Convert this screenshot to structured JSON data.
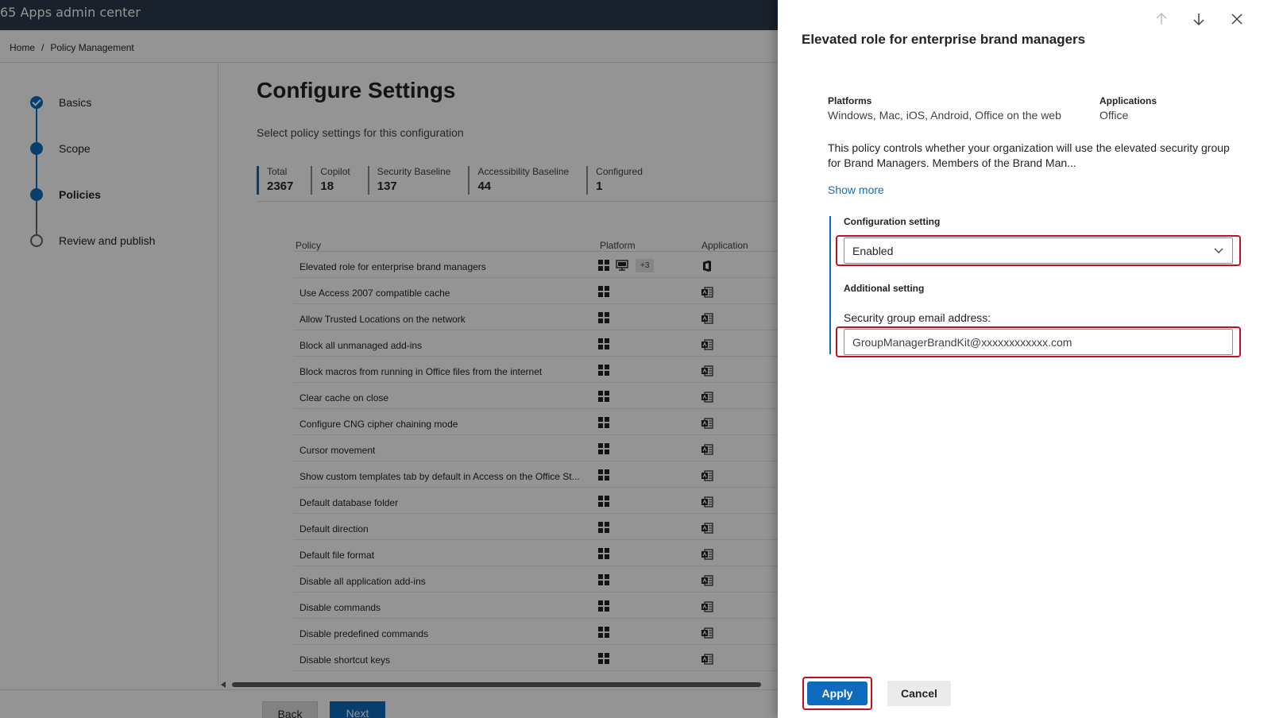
{
  "app": {
    "title": "65 Apps admin center",
    "breadcrumb": {
      "home": "Home",
      "sep": "/",
      "current": "Policy Management"
    }
  },
  "steps": [
    {
      "label": "Basics",
      "state": "complete"
    },
    {
      "label": "Scope",
      "state": "complete"
    },
    {
      "label": "Policies",
      "state": "current"
    },
    {
      "label": "Review and publish",
      "state": "pending"
    }
  ],
  "main": {
    "heading": "Configure Settings",
    "subheading": "Select policy settings for this configuration",
    "stats": [
      {
        "label": "Total",
        "value": "2367"
      },
      {
        "label": "Copilot",
        "value": "18"
      },
      {
        "label": "Security Baseline",
        "value": "137"
      },
      {
        "label": "Accessibility Baseline",
        "value": "44"
      },
      {
        "label": "Configured",
        "value": "1"
      }
    ],
    "table": {
      "headers": {
        "policy": "Policy",
        "platform": "Platform",
        "application": "Application"
      },
      "rows": [
        "Elevated role for enterprise brand managers",
        "Use Access 2007 compatible cache",
        "Allow Trusted Locations on the network",
        "Block all unmanaged add-ins",
        "Block macros from running in Office files from the internet",
        "Clear cache on close",
        "Configure CNG cipher chaining mode",
        "Cursor movement",
        "Show custom templates tab by default in Access on the Office St...",
        "Default database folder",
        "Default direction",
        "Default file format",
        "Disable all application add-ins",
        "Disable commands",
        "Disable predefined commands",
        "Disable shortcut keys"
      ],
      "first_row_extra_platforms": "+3"
    },
    "buttons": {
      "back": "Back",
      "next": "Next"
    }
  },
  "panel": {
    "title": "Elevated role for enterprise brand managers",
    "platforms_label": "Platforms",
    "platforms_value": "Windows, Mac, iOS, Android, Office on the web",
    "applications_label": "Applications",
    "applications_value": "Office",
    "description_line1": "This policy controls whether your organization will use the elevated security group",
    "description_line2": "for Brand Managers. Members of the Brand Man...",
    "show_more": "Show more",
    "config_label": "Configuration setting",
    "config_value": "Enabled",
    "additional_label": "Additional setting",
    "email_label": "Security group email address:",
    "email_value": "GroupManagerBrandKit@xxxxxxxxxxxx.com",
    "apply": "Apply",
    "cancel": "Cancel"
  },
  "colors": {
    "accent": "#0f6cbd",
    "highlight": "#c50f1f",
    "topbar": "#2b3a4d"
  }
}
